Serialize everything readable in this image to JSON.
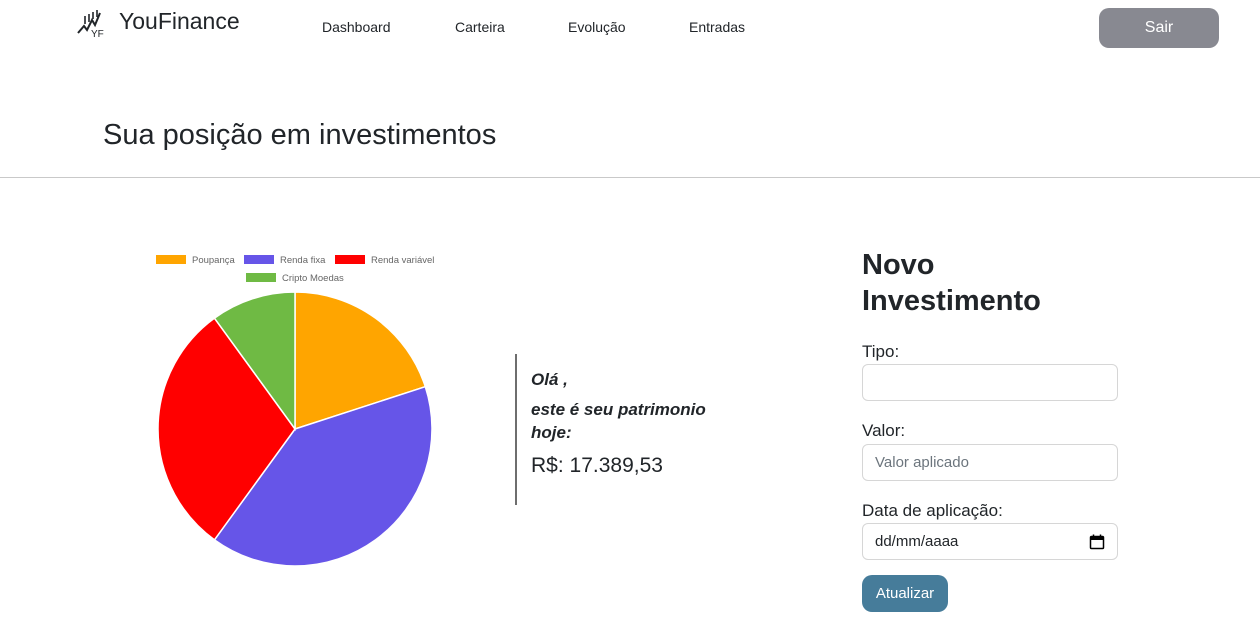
{
  "brand": {
    "name": "YouFinance",
    "logo_text": "YF",
    "logo_icon": "chart-trend-icon"
  },
  "nav": {
    "links": [
      {
        "label": "Dashboard"
      },
      {
        "label": "Carteira"
      },
      {
        "label": "Evolução"
      },
      {
        "label": "Entradas"
      }
    ],
    "logout_label": "Sair"
  },
  "page": {
    "title": "Sua posição em investimentos"
  },
  "chart_data": {
    "type": "pie",
    "legend_position": "top",
    "categories": [
      "Poupança",
      "Renda fixa",
      "Renda variável",
      "Cripto Moedas"
    ],
    "values": [
      20,
      40,
      30,
      10
    ],
    "colors": [
      "#ffa500",
      "#6655e8",
      "#ff0000",
      "#6fba44"
    ]
  },
  "summary": {
    "greeting": "Olá ,",
    "message": "este é seu patrimonio hoje:",
    "balance": "R$: 17.389,53"
  },
  "form": {
    "title": "Novo Investimento",
    "tipo_label": "Tipo:",
    "tipo_value": "",
    "valor_label": "Valor:",
    "valor_placeholder": "Valor aplicado",
    "data_label": "Data de aplicação:",
    "data_placeholder": "dd/mm/aaaa",
    "submit_label": "Atualizar"
  },
  "colors": {
    "logout_button": "#888991",
    "submit_button": "#467c9a",
    "divider": "#c9c9c9"
  }
}
